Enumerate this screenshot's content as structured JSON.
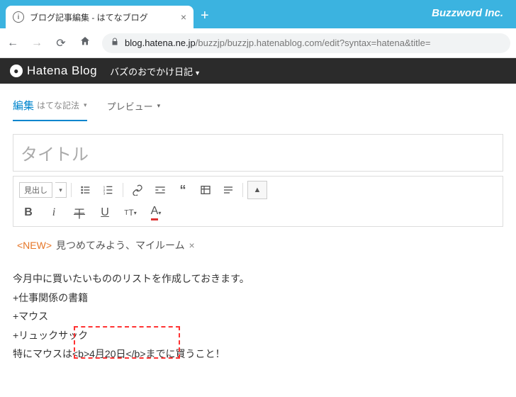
{
  "company": "Buzzword Inc.",
  "browser": {
    "tab_title": "ブログ記事編集 - はてなブログ",
    "url_domain": "blog.hatena.ne.jp",
    "url_path": "/buzzjp/buzzjp.hatenablog.com/edit?syntax=hatena&title="
  },
  "site": {
    "brand": "Hatena Blog",
    "blog_name": "バズのおでかけ日記"
  },
  "tabs": {
    "edit_primary": "編集",
    "edit_secondary": "はてな記法",
    "preview": "プレビュー"
  },
  "editor": {
    "title_placeholder": "タイトル",
    "heading_select": "見出し",
    "tag_new_label": "<NEW>",
    "tag_text": "見つめてみよう、マイルーム",
    "body_lines": [
      "今月中に買いたいもののリストを作成しておきます。",
      "+仕事関係の書籍",
      "+マウス",
      "+リュックサック",
      "特にマウスは<b>4月20日</b>までに買うこと！"
    ]
  }
}
